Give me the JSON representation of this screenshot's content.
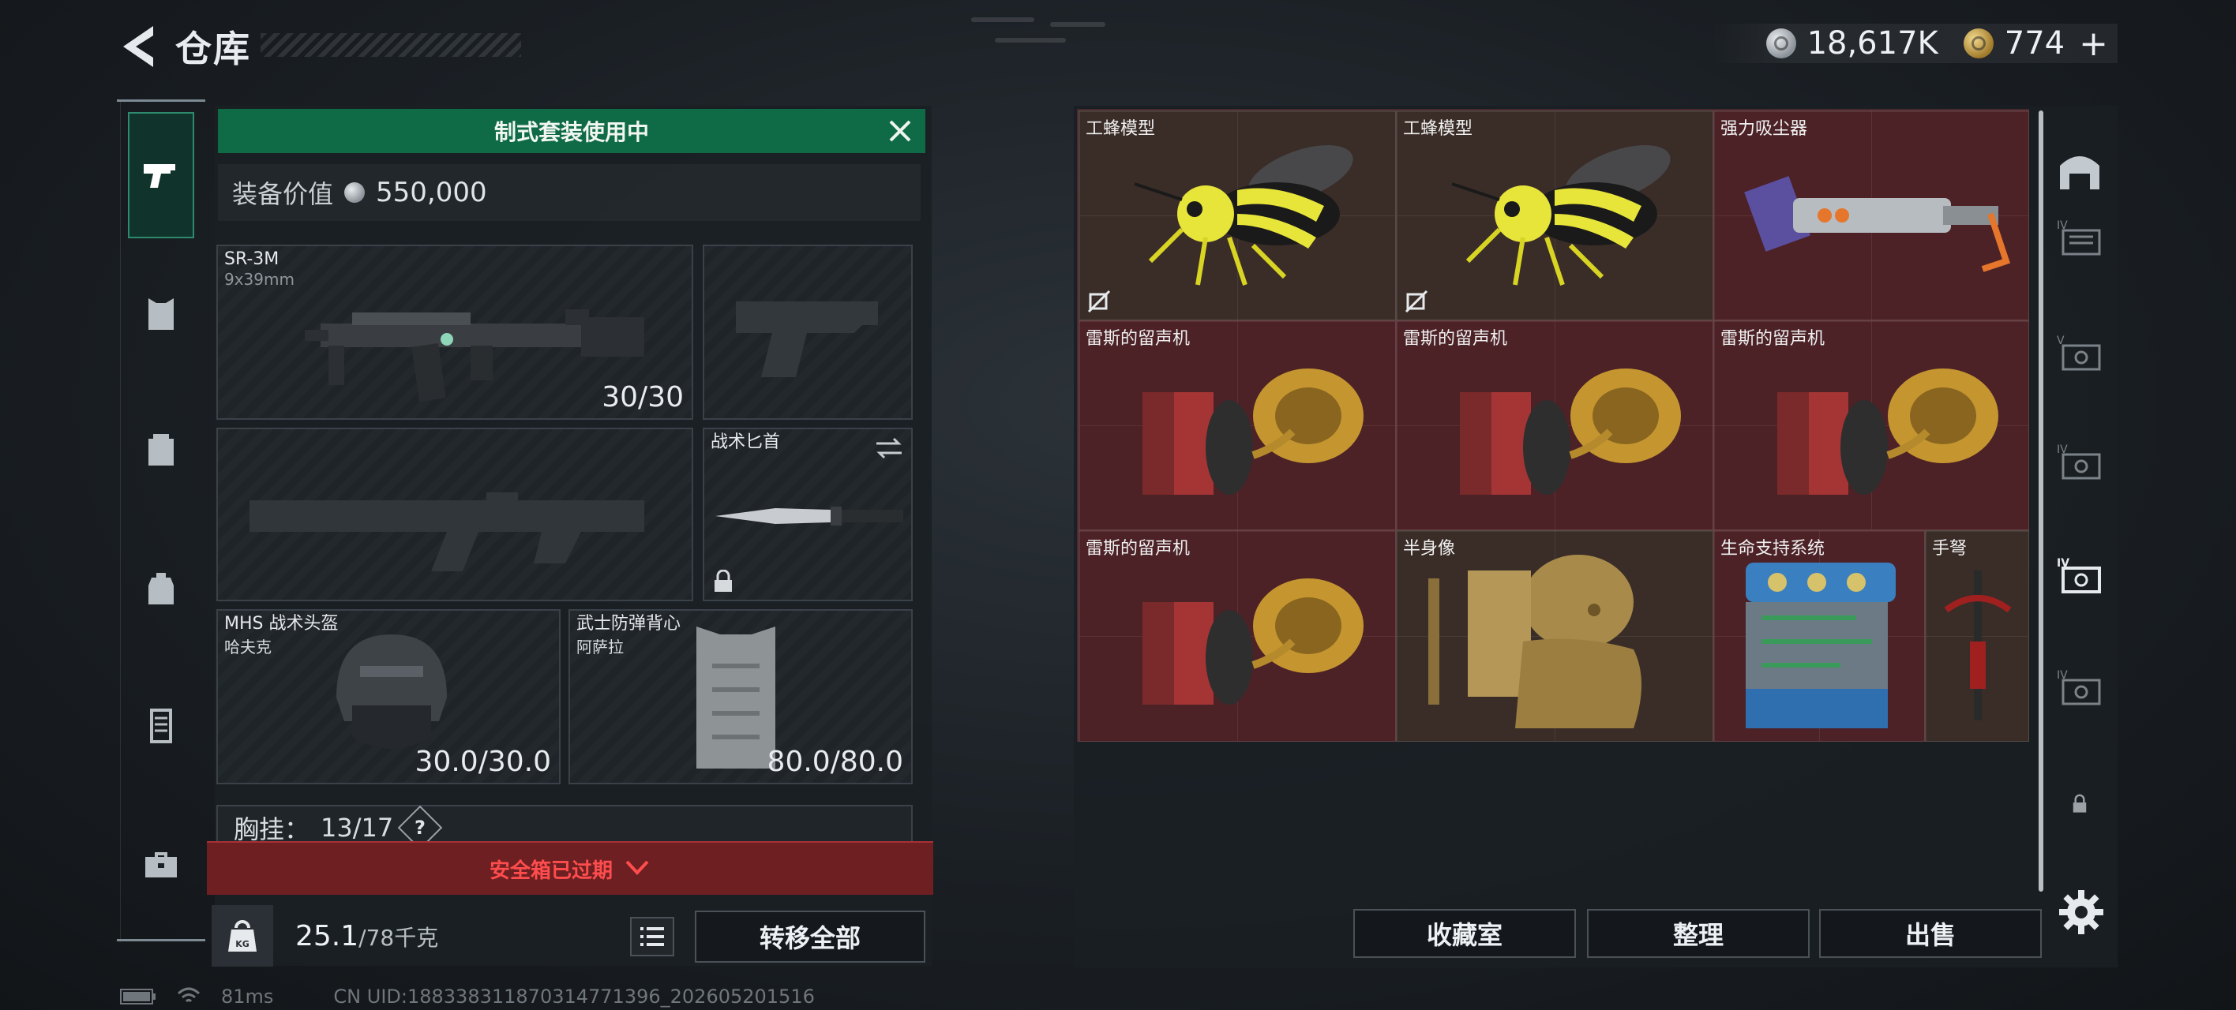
{
  "header": {
    "title": "仓库",
    "back_icon": "back-arrow-icon"
  },
  "currency": [
    {
      "icon": "silver-coin-icon",
      "value": "18,617K"
    },
    {
      "icon": "gold-coin-icon",
      "value": "774"
    }
  ],
  "currency_plus": "+",
  "left_rail": [
    "pistol-icon",
    "armor-icon",
    "backpack-icon",
    "bag-icon",
    "locker-icon",
    "briefcase-icon"
  ],
  "equipment": {
    "banner": "制式套装使用中",
    "value_label": "装备价值",
    "value": "550,000",
    "primary": {
      "name": "SR-3M",
      "caliber": "9x39mm",
      "ammo": "30/30"
    },
    "secondary_empty": "pistol-silhouette",
    "melee": {
      "name": "战术匕首"
    },
    "helmet": {
      "name": "MHS 战术头盔",
      "sub": "哈夫克",
      "durability": "30.0/30.0"
    },
    "vest": {
      "name": "武士防弹背心",
      "sub": "阿萨拉",
      "durability": "80.0/80.0"
    },
    "chest_rig": {
      "label": "胸挂：",
      "count": "13/17",
      "help": "?"
    },
    "safebox": "安全箱已过期",
    "weight": {
      "value": "25.1",
      "capacity": "/78千克",
      "icon_text": "KG"
    },
    "move_all": "转移全部"
  },
  "storage": {
    "items": [
      {
        "name": "工蜂模型",
        "art": "wasp"
      },
      {
        "name": "工蜂模型",
        "art": "wasp"
      },
      {
        "name": "强力吸尘器",
        "art": "vacuum"
      },
      {
        "name": "雷斯的留声机",
        "art": "gramophone"
      },
      {
        "name": "雷斯的留声机",
        "art": "gramophone"
      },
      {
        "name": "雷斯的留声机",
        "art": "gramophone"
      },
      {
        "name": "雷斯的留声机",
        "art": "gramophone"
      },
      {
        "name": "半身像",
        "art": "bust"
      },
      {
        "name": "生命支持系统",
        "art": "life-support"
      },
      {
        "name": "手弩",
        "art": "crossbow"
      }
    ],
    "buttons": {
      "collection": "收藏室",
      "sort": "整理",
      "sell": "出售"
    }
  },
  "right_rail": [
    "warehouse-icon",
    "tier-iv-storage-icon",
    "tier-v-storage-icon",
    "tier-v-storage-icon",
    "tier-iv-storage-icon",
    "tier-iv-storage-icon",
    "tier-iv-storage-icon",
    "lock-icon",
    "settings-icon"
  ],
  "status": {
    "ping": "81ms",
    "uid": "CN UID:18833831187031477139​6_202605201516"
  },
  "colors": {
    "banner": "#0f6b45",
    "safebox": "#6e1f22",
    "alert_text": "#ff4d4d",
    "gold_cell": "#3a2d28",
    "red_cell": "#4c2227"
  }
}
